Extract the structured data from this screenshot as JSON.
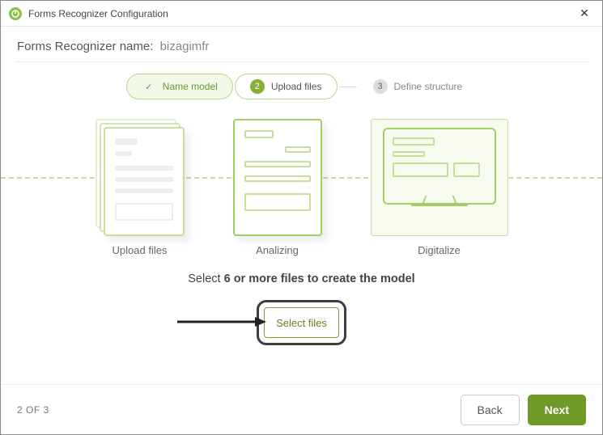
{
  "window": {
    "title": "Forms Recognizer Configuration"
  },
  "header": {
    "name_label": "Forms Recognizer name:",
    "name_value": "bizagimfr"
  },
  "stepper": {
    "step1_label": "Name model",
    "step2_num": "2",
    "step2_label": "Upload files",
    "step3_num": "3",
    "step3_label": "Define structure"
  },
  "cards": {
    "upload": "Upload files",
    "analyze": "Analizing",
    "digitalize": "Digitalize"
  },
  "instruction": {
    "prefix": "Select ",
    "bold": "6 or more files to create the model"
  },
  "actions": {
    "select_files": "Select files"
  },
  "footer": {
    "page_indicator": "2 OF 3",
    "back": "Back",
    "next": "Next"
  }
}
